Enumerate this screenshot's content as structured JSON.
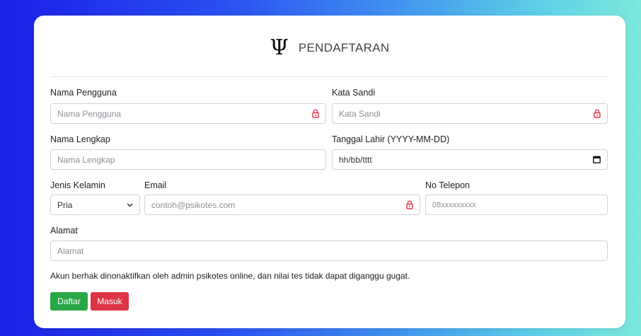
{
  "header": {
    "icon": "psi-icon",
    "title": "PENDAFTARAN"
  },
  "fields": {
    "username": {
      "label": "Nama Pengguna",
      "placeholder": "Nama Pengguna"
    },
    "password": {
      "label": "Kata Sandi",
      "placeholder": "Kata Sandi"
    },
    "fullname": {
      "label": "Nama Lengkap",
      "placeholder": "Nama Lengkap"
    },
    "birthdate": {
      "label": "Tanggal Lahir (YYYY-MM-DD)",
      "placeholder": "hh/bb/tttt"
    },
    "gender": {
      "label": "Jenis Kelamin",
      "value": "Pria"
    },
    "email": {
      "label": "Email",
      "placeholder": "contoh@psikotes.com"
    },
    "phone": {
      "label": "No Telepon",
      "placeholder": "08xxxxxxxxx"
    },
    "address": {
      "label": "Alamat",
      "placeholder": "Alamat"
    }
  },
  "note": "Akun berhak dinonaktifkan oleh admin psikotes online, dan nilai tes tidak dapat diganggu gugat.",
  "buttons": {
    "register": "Daftar",
    "login": "Masuk"
  },
  "colors": {
    "register": "#28a745",
    "login": "#dc3545",
    "lock_icon": "#dc3545"
  }
}
